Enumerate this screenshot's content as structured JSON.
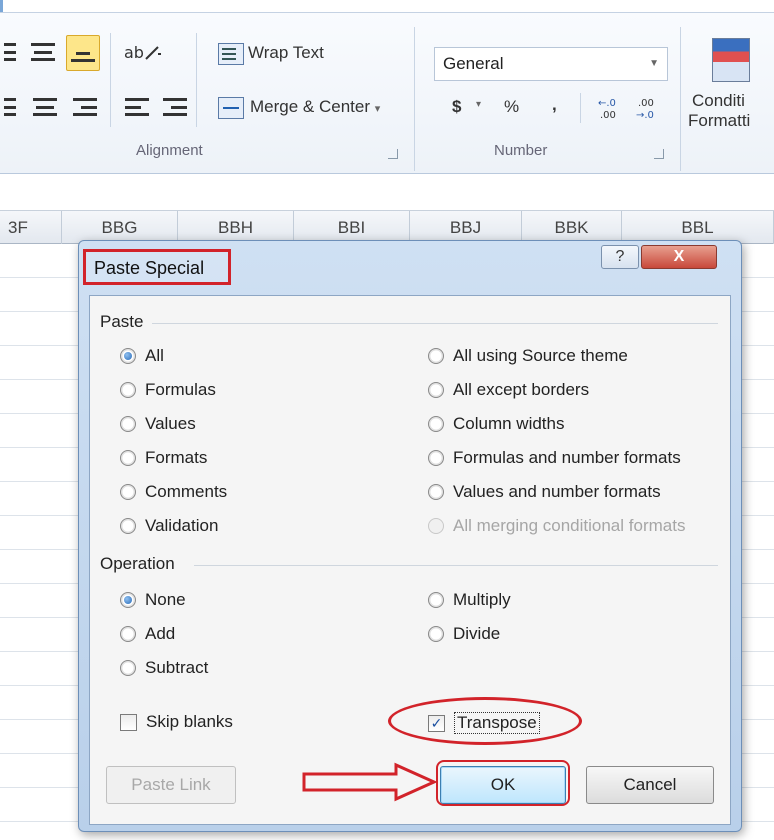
{
  "ribbon": {
    "wrap_text": "Wrap Text",
    "merge_center": "Merge & Center",
    "merge_arrow": "▾",
    "alignment_group": "Alignment",
    "number_format": "General",
    "dollar": "$",
    "percent": "%",
    "comma": ",",
    "inc_decimal": "←.0\n.00",
    "dec_decimal": ".00\n→.0",
    "number_group": "Number",
    "conditional_1": "Conditi",
    "conditional_2": "Formatti"
  },
  "columns": {
    "first": "3F",
    "names": [
      "BBG",
      "BBH",
      "BBI",
      "BBJ",
      "BBK",
      "BBL"
    ]
  },
  "dialog": {
    "title": "Paste Special",
    "help": "?",
    "close": "X",
    "paste_section": "Paste",
    "paste_left": [
      {
        "label": "All",
        "checked": true
      },
      {
        "label": "Formulas",
        "checked": false
      },
      {
        "label": "Values",
        "checked": false
      },
      {
        "label": "Formats",
        "checked": false
      },
      {
        "label": "Comments",
        "checked": false
      },
      {
        "label": "Validation",
        "checked": false
      }
    ],
    "paste_right": [
      {
        "label": "All using Source theme",
        "checked": false,
        "disabled": false
      },
      {
        "label": "All except borders",
        "checked": false,
        "disabled": false
      },
      {
        "label": "Column widths",
        "checked": false,
        "disabled": false
      },
      {
        "label": "Formulas and number formats",
        "checked": false,
        "disabled": false
      },
      {
        "label": "Values and number formats",
        "checked": false,
        "disabled": false
      },
      {
        "label": "All merging conditional formats",
        "checked": false,
        "disabled": true
      }
    ],
    "operation_section": "Operation",
    "operation_left": [
      {
        "label": "None",
        "checked": true
      },
      {
        "label": "Add",
        "checked": false
      },
      {
        "label": "Subtract",
        "checked": false
      }
    ],
    "operation_right": [
      {
        "label": "Multiply",
        "checked": false
      },
      {
        "label": "Divide",
        "checked": false
      }
    ],
    "skip_blanks": {
      "label": "Skip blanks",
      "checked": false
    },
    "transpose": {
      "label": "Transpose",
      "checked": true
    },
    "paste_link": "Paste Link",
    "ok": "OK",
    "cancel": "Cancel"
  },
  "colors": {
    "annotation_red": "#d2232a",
    "dialog_frame": "#b9d0ea"
  }
}
